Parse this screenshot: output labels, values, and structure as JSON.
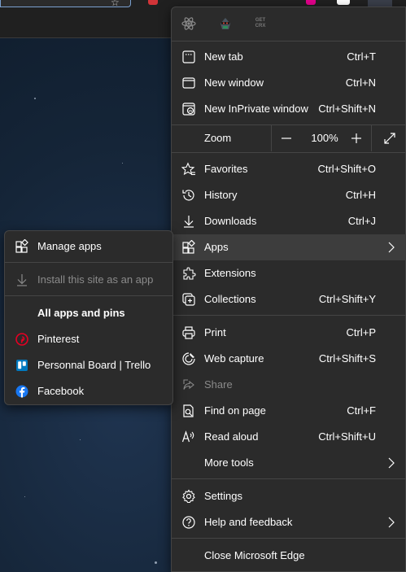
{
  "colors": {
    "menu_bg": "#2b2b2b",
    "highlight": "#3d3d3d",
    "separator": "#454545",
    "disabled_text": "#8a8a8a",
    "pinterest": "#e60023",
    "trello": "#0079bf",
    "facebook": "#1877f2"
  },
  "extensions": [
    {
      "name": "react-devtools-icon"
    },
    {
      "name": "ninja-extension-icon"
    },
    {
      "name": "get-crx-icon",
      "text_line1": "GET",
      "text_line2": "CRX"
    }
  ],
  "menu": {
    "new_tab": {
      "label": "New tab",
      "shortcut": "Ctrl+T",
      "icon": "new-tab-icon"
    },
    "new_window": {
      "label": "New window",
      "shortcut": "Ctrl+N",
      "icon": "new-window-icon"
    },
    "new_inprivate": {
      "label": "New InPrivate window",
      "shortcut": "Ctrl+Shift+N",
      "icon": "inprivate-icon"
    },
    "zoom": {
      "label": "Zoom",
      "value": "100%",
      "minus": "—",
      "plus": "+"
    },
    "favorites": {
      "label": "Favorites",
      "shortcut": "Ctrl+Shift+O",
      "icon": "favorites-icon"
    },
    "history": {
      "label": "History",
      "shortcut": "Ctrl+H",
      "icon": "history-icon"
    },
    "downloads": {
      "label": "Downloads",
      "shortcut": "Ctrl+J",
      "icon": "downloads-icon"
    },
    "apps": {
      "label": "Apps",
      "icon": "apps-icon",
      "has_submenu": true
    },
    "extensions": {
      "label": "Extensions",
      "icon": "extensions-icon"
    },
    "collections": {
      "label": "Collections",
      "shortcut": "Ctrl+Shift+Y",
      "icon": "collections-icon"
    },
    "print": {
      "label": "Print",
      "shortcut": "Ctrl+P",
      "icon": "print-icon"
    },
    "web_capture": {
      "label": "Web capture",
      "shortcut": "Ctrl+Shift+S",
      "icon": "web-capture-icon"
    },
    "share": {
      "label": "Share",
      "icon": "share-icon",
      "disabled": true
    },
    "find_on_page": {
      "label": "Find on page",
      "shortcut": "Ctrl+F",
      "icon": "find-icon"
    },
    "read_aloud": {
      "label": "Read aloud",
      "shortcut": "Ctrl+Shift+U",
      "icon": "read-aloud-icon"
    },
    "more_tools": {
      "label": "More tools",
      "has_submenu": true
    },
    "settings": {
      "label": "Settings",
      "icon": "gear-icon"
    },
    "help": {
      "label": "Help and feedback",
      "icon": "help-icon",
      "has_submenu": true
    },
    "close": {
      "label": "Close Microsoft Edge"
    }
  },
  "apps_submenu": {
    "manage_apps": {
      "label": "Manage apps",
      "icon": "apps-icon"
    },
    "install_site": {
      "label": "Install this site as an app",
      "icon": "download-icon",
      "disabled": true
    },
    "header": {
      "label": "All apps and pins"
    },
    "apps": [
      {
        "label": "Pinterest",
        "icon": "pinterest-icon"
      },
      {
        "label": "Personnal Board | Trello",
        "icon": "trello-icon"
      },
      {
        "label": "Facebook",
        "icon": "facebook-icon"
      }
    ]
  }
}
